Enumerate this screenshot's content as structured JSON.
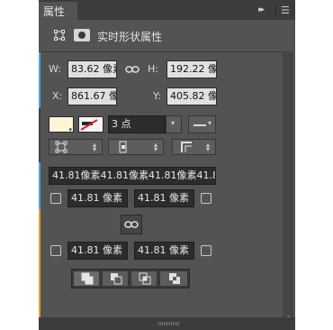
{
  "panel": {
    "tab_title": "属性",
    "collapse_glyph": "▸▸",
    "menu_glyph": "☰"
  },
  "header": {
    "title": "实时形状属性"
  },
  "transform": {
    "w_label": "W:",
    "w_value": "83.62 像素",
    "h_label": "H:",
    "h_value": "192.22 像",
    "x_label": "X:",
    "x_value": "861.67 像:",
    "y_label": "Y:",
    "y_value": "405.82 像"
  },
  "stroke": {
    "width_value": "3 点"
  },
  "corners": {
    "all_value": "41.81像素41.81像素41.81像素41.81",
    "top_left": "41.81 像素",
    "top_right": "41.81 像素",
    "bottom_left": "41.81 像素",
    "bottom_right": "41.81 像素"
  },
  "colors": {
    "fill_swatch": "#fff5d6",
    "accent_blue": "#4ea0ea",
    "accent_orange": "#e3a426",
    "panel_bg": "#535353"
  }
}
